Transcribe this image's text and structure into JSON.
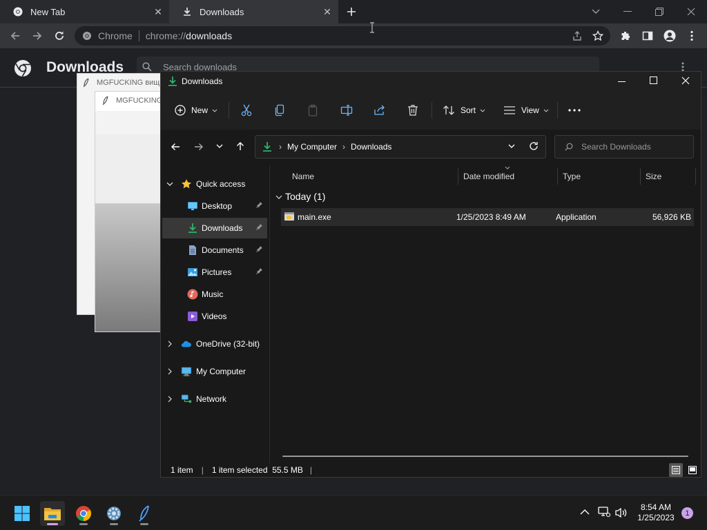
{
  "chrome": {
    "tabs": [
      {
        "label": "New Tab"
      },
      {
        "label": "Downloads"
      }
    ],
    "omnibox": {
      "site_label": "Chrome",
      "url_scheme": "chrome://",
      "url_path": "downloads"
    },
    "page_title": "Downloads",
    "search_placeholder": "Search downloads"
  },
  "background_window": {
    "title_1": "MGFUCKING вищ",
    "title_2": "MGFUCKING"
  },
  "explorer": {
    "title": "Downloads",
    "toolbar": {
      "new_label": "New",
      "sort_label": "Sort",
      "view_label": "View"
    },
    "address": {
      "crumbs": [
        "My Computer",
        "Downloads"
      ]
    },
    "search_placeholder": "Search Downloads",
    "nav": {
      "quick_access": "Quick access",
      "pinned": [
        {
          "label": "Desktop",
          "icon": "desktop-icon"
        },
        {
          "label": "Downloads",
          "icon": "download-icon"
        },
        {
          "label": "Documents",
          "icon": "document-icon"
        },
        {
          "label": "Pictures",
          "icon": "pictures-icon"
        },
        {
          "label": "Music",
          "icon": "music-icon"
        },
        {
          "label": "Videos",
          "icon": "videos-icon"
        }
      ],
      "roots": [
        {
          "label": "OneDrive (32-bit)",
          "icon": "cloud-icon"
        },
        {
          "label": "My Computer",
          "icon": "computer-icon"
        },
        {
          "label": "Network",
          "icon": "network-icon"
        }
      ]
    },
    "columns": [
      "Name",
      "Date modified",
      "Type",
      "Size"
    ],
    "group_header": "Today (1)",
    "files": [
      {
        "name": "main.exe",
        "date": "1/25/2023 8:49 AM",
        "type": "Application",
        "size": "56,926 KB"
      }
    ],
    "status": {
      "count": "1 item",
      "selected": "1 item selected  55.5 MB"
    }
  },
  "taskbar": {
    "time": "8:54 AM",
    "date": "1/25/2023",
    "notification_count": "1"
  },
  "colors": {
    "accent_green": "#2fb36b",
    "folder_yellow": "#f5c342",
    "badge": "#c9a2e8"
  }
}
